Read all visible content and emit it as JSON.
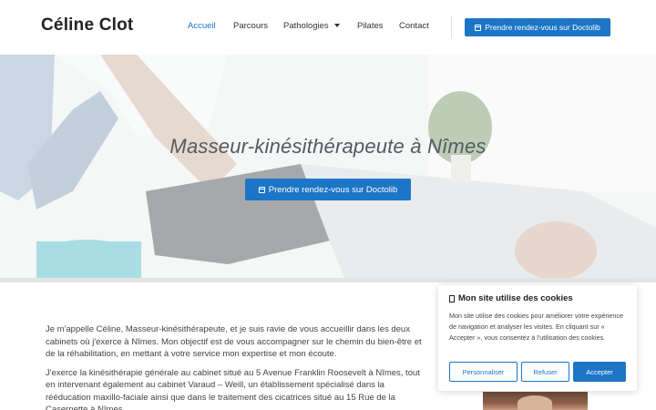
{
  "header": {
    "logo": "Céline Clot",
    "nav": [
      {
        "label": "Accueil",
        "active": true
      },
      {
        "label": "Parcours",
        "active": false
      },
      {
        "label": "Pathologies",
        "active": false,
        "has_dropdown": true
      },
      {
        "label": "Pilates",
        "active": false
      },
      {
        "label": "Contact",
        "active": false
      }
    ],
    "cta": "Prendre rendez-vous sur Doctolib"
  },
  "hero": {
    "title": "Masseur-kinésithérapeute à Nîmes",
    "cta": "Prendre rendez-vous sur Doctolib"
  },
  "content": {
    "paragraphs": [
      "Je m'appelle Céline, Masseur-kinésithérapeute, et je suis ravie de vous accueillir dans les deux cabinets où j'exerce à Nîmes. Mon objectif est de vous accompagner sur le chemin du bien-être et de la réhabilitation, en mettant à votre service mon expertise et mon écoute.",
      "J'exerce la kinésithérapie générale au cabinet situé au 5 Avenue Franklin Roosevelt à Nîmes, tout en intervenant également au cabinet Varaud – Weill, un établissement spécialisé dans la rééducation maxillo-faciale ainsi que dans le traitement des cicatrices situé au 15 Rue de la Casernette à Nîmes."
    ]
  },
  "cookie": {
    "title": "Mon site utilise des cookies",
    "text": "Mon site utilise des cookies pour améliorer votre expérience de navigation et analyser les visites. En cliquant sur « Accepter », vous consentez à l'utilisation des cookies.",
    "buttons": {
      "settings": "Personnaliser",
      "refuse": "Refuser",
      "accept": "Accepter"
    }
  },
  "colors": {
    "accent": "#1c75c7",
    "text": "#333333",
    "hero_title": "#555a5f"
  },
  "icons": {
    "calendar": "calendar-check-icon",
    "dropdown": "chevron-down-icon",
    "cookie": "cookie-icon"
  }
}
